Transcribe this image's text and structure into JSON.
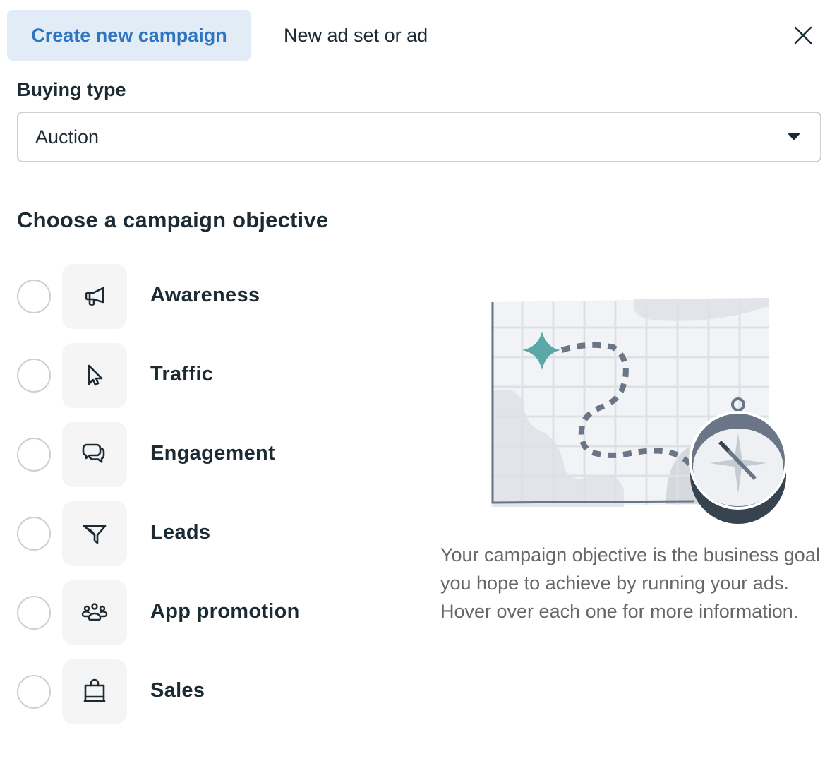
{
  "tabs": [
    {
      "label": "Create new campaign",
      "active": true
    },
    {
      "label": "New ad set or ad",
      "active": false
    }
  ],
  "close_icon": "close-icon",
  "buying_type": {
    "label": "Buying type",
    "selected": "Auction",
    "icon": "caret-down-icon"
  },
  "objective_section": {
    "title": "Choose a campaign objective",
    "options": [
      {
        "label": "Awareness",
        "icon": "megaphone-icon",
        "selected": false
      },
      {
        "label": "Traffic",
        "icon": "cursor-icon",
        "selected": false
      },
      {
        "label": "Engagement",
        "icon": "chat-bubbles-icon",
        "selected": false
      },
      {
        "label": "Leads",
        "icon": "funnel-icon",
        "selected": false
      },
      {
        "label": "App promotion",
        "icon": "people-group-icon",
        "selected": false
      },
      {
        "label": "Sales",
        "icon": "shopping-bag-icon",
        "selected": false
      }
    ]
  },
  "illustration": {
    "name": "map-with-compass-illustration",
    "accent_color": "#5aa9a6"
  },
  "help_text": "Your campaign objective is the business goal you hope to achieve by running your ads. Hover over each one for more information.",
  "colors": {
    "accent": "#2f74c0",
    "accent_bg": "#e2ecf6",
    "text_primary": "#1c2b33",
    "text_secondary": "#65676b"
  }
}
